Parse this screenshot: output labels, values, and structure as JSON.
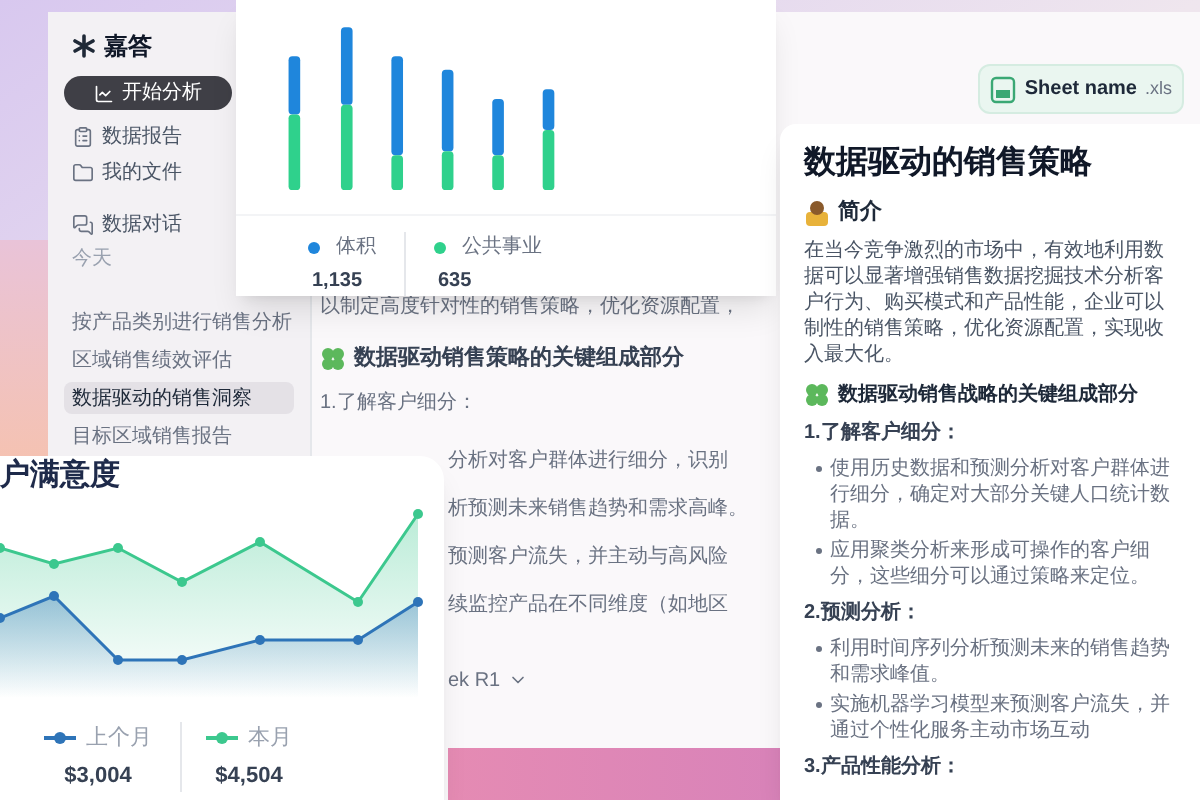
{
  "sidebar": {
    "logo": "嘉答",
    "primary_button": "开始分析",
    "nav": [
      {
        "label": "数据报告",
        "kind": "report"
      },
      {
        "label": "我的文件",
        "kind": "files"
      },
      {
        "label": "数据对话",
        "kind": "chat"
      }
    ],
    "section_label": "今天",
    "history": [
      {
        "label": "按产品类别进行销售分析",
        "selected": false
      },
      {
        "label": "区域销售绩效评估",
        "selected": false
      },
      {
        "label": "数据驱动的销售洞察",
        "selected": true
      },
      {
        "label": "目标区域销售报告",
        "selected": false
      }
    ]
  },
  "background_document": {
    "intro_fragment": "以制定高度针对性的销售策略，优化资源配置，",
    "heading": "数据驱动销售策略的关键组成部分",
    "subheading": "1.了解客户细分：",
    "fragments": [
      "分析对客户群体进行细分，识别",
      "析预测未来销售趋势和需求高峰。",
      "预测客户流失，并主动与高风险",
      "续监控产品在不同维度（如地区"
    ],
    "model_picker": "ek R1"
  },
  "bar_chart_card": {
    "legend": [
      {
        "name": "体积",
        "value": "1,135",
        "color": "#1f86dc"
      },
      {
        "name": "公共事业",
        "value": "635",
        "color": "#2fd18c"
      }
    ]
  },
  "line_chart_card": {
    "title": "户满意度",
    "legend": [
      {
        "name": "上个月",
        "value": "$3,004",
        "color": "#2e74b8"
      },
      {
        "name": "本月",
        "value": "$4,504",
        "color": "#3cc88e"
      }
    ]
  },
  "file_chip": {
    "name": "Sheet name",
    "extension": ".xls"
  },
  "document_card": {
    "title": "数据驱动的销售策略",
    "blocks": [
      {
        "kind": "intro_heading",
        "text": "简介"
      },
      {
        "kind": "paragraph",
        "text": "在当今竞争激烈的市场中，有效地利用数据可以显著增强销售数据挖掘技术分析客户行为、购买模式和产品性能，企业可以制性的销售策略，优化资源配置，实现收入最大化。"
      },
      {
        "kind": "section_heading",
        "text": "数据驱动销售战略的关键组成部分"
      },
      {
        "kind": "subheading",
        "text": "1.了解客户细分："
      },
      {
        "kind": "bullets",
        "items": [
          "使用历史数据和预测分析对客户群体进行细分，确定对大部分关键人口统计数据。",
          "应用聚类分析来形成可操作的客户细分，这些细分可以通过策略来定位。"
        ]
      },
      {
        "kind": "subheading",
        "text": "2.预测分析："
      },
      {
        "kind": "bullets",
        "items": [
          "利用时间序列分析预测未来的销售趋势和需求峰值。",
          "实施机器学习模型来预测客户流失，并通过个性化服务主动市场互动"
        ]
      },
      {
        "kind": "subheading",
        "text": "3.产品性能分析："
      }
    ]
  }
}
